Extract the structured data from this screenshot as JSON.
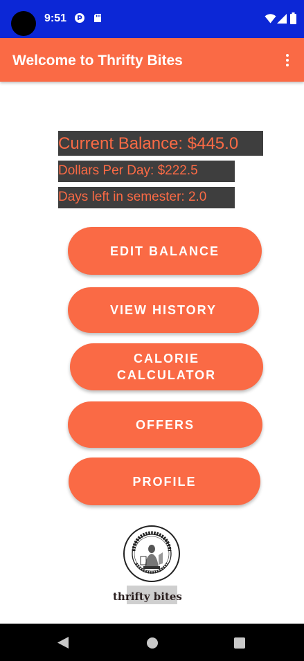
{
  "status_bar": {
    "time": "9:51"
  },
  "app_bar": {
    "title": "Welcome to Thrifty Bites"
  },
  "info": {
    "current_balance": "Current Balance: $445.0",
    "dollars_per_day": "Dollars Per Day: $222.5",
    "days_left": "Days left in semester: 2.0"
  },
  "buttons": {
    "edit_balance": "EDIT BALANCE",
    "view_history": "VIEW HISTORY",
    "calorie_calculator": "CALORIE CALCULATOR",
    "offers": "OFFERS",
    "profile": "PROFILE"
  },
  "logo": {
    "seal_text": "PACE UNIVERSITY · NEW YORK · WESTCHESTER",
    "brand": "thrifty bites"
  },
  "colors": {
    "status_bar": "#0c27d6",
    "accent": "#fa6a45",
    "info_bg": "#3e3e3e"
  },
  "icons": [
    "camera-cutout",
    "pocket-casts-icon",
    "sd-card-icon",
    "wifi-icon",
    "cellular-icon",
    "battery-icon",
    "more-vert-icon",
    "nav-back-icon",
    "nav-home-icon",
    "nav-recents-icon"
  ]
}
